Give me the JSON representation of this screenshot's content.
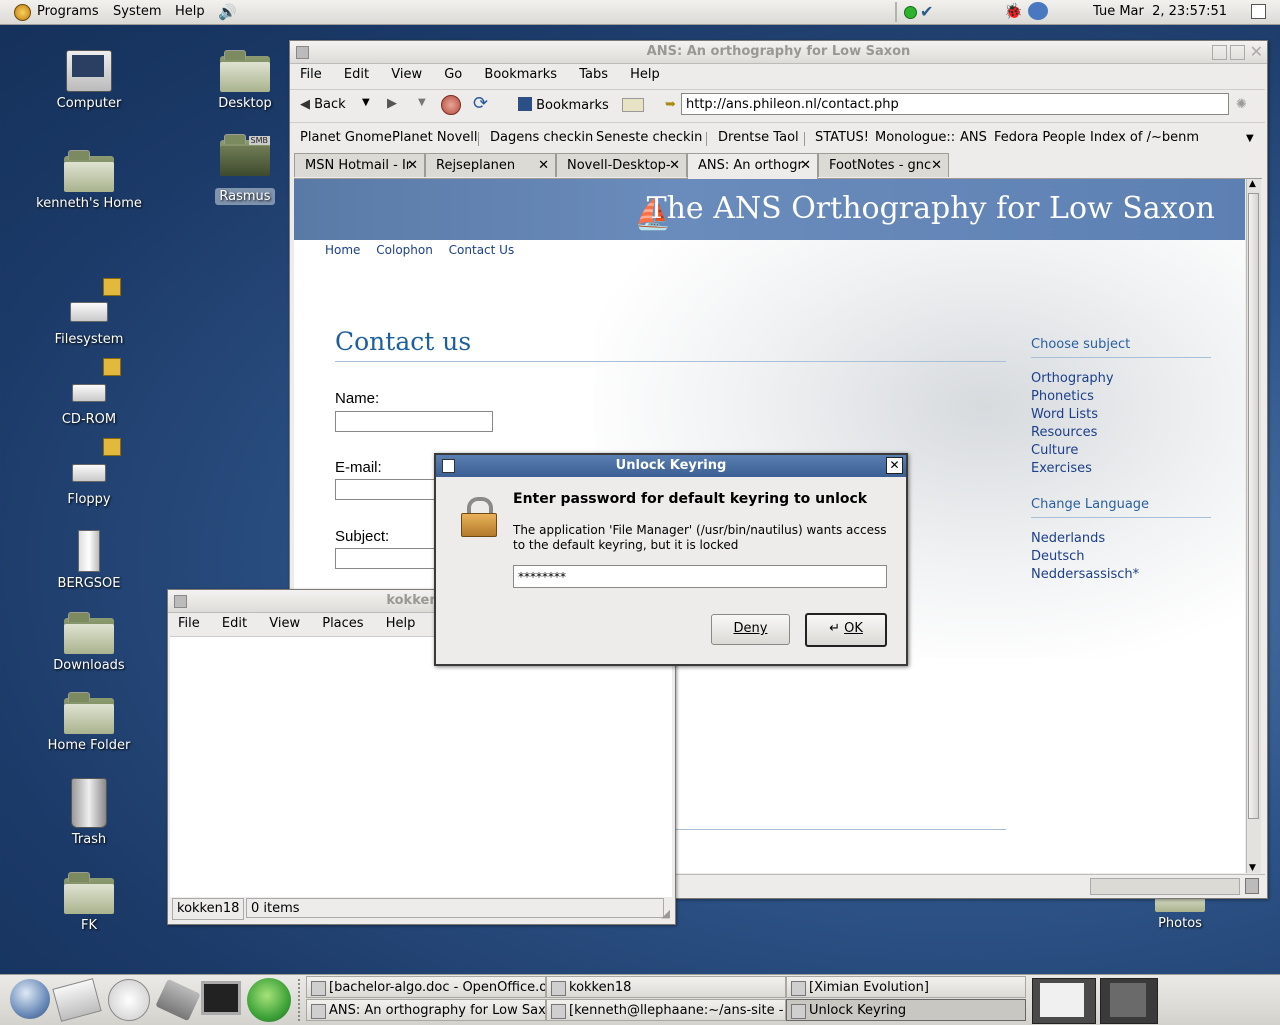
{
  "top_panel": {
    "menus": [
      "Programs",
      "System",
      "Help"
    ],
    "clock": "Tue Mar  2, 23:57:51"
  },
  "desktop": {
    "icons": [
      "Computer",
      "Desktop",
      "kenneth's Home",
      "Rasmus",
      "Filesystem",
      "CD-ROM",
      "Floppy",
      "BERGSOE",
      "Downloads",
      "Home Folder",
      "Trash",
      "FK",
      "Photos"
    ],
    "smb_badge": "SMB"
  },
  "browser": {
    "title": "ANS: An orthography for Low Saxon",
    "menus": [
      "File",
      "Edit",
      "View",
      "Go",
      "Bookmarks",
      "Tabs",
      "Help"
    ],
    "toolbar": {
      "back": "Back",
      "bookmarks": "Bookmarks"
    },
    "url": "http://ans.phileon.nl/contact.php",
    "bookmarks": [
      "Planet Gnome",
      "Planet Novell",
      "Dagens checkin",
      "Seneste checkin",
      "Drentse Taol",
      "STATUS!",
      "Monologue::",
      "ANS",
      "Fedora People",
      "Index of /~benm"
    ],
    "tabs": [
      "MSN Hotmail - Ir",
      "Rejseplanen",
      "Novell-Desktop-",
      "ANS: An orthogr",
      "FootNotes - gnc"
    ],
    "page": {
      "banner": "The ANS Orthography for Low Saxon",
      "nav": [
        "Home",
        "Colophon",
        "Contact Us"
      ],
      "heading": "Contact us",
      "fields": [
        "Name:",
        "E-mail:",
        "Subject:"
      ],
      "sidebar": {
        "subject_title": "Choose subject",
        "subjects": [
          "Orthography",
          "Phonetics",
          "Word Lists",
          "Resources",
          "Culture",
          "Exercises"
        ],
        "lang_title": "Change Language",
        "languages": [
          "Nederlands",
          "Deutsch",
          "Neddersassisch*"
        ]
      }
    }
  },
  "file_manager": {
    "title": "kokken18",
    "menus": [
      "File",
      "Edit",
      "View",
      "Places",
      "Help"
    ],
    "status_location": "kokken18",
    "status_count": "0 items"
  },
  "dialog": {
    "title": "Unlock Keyring",
    "heading": "Enter password for default keyring to unlock",
    "message": "The application 'File Manager' (/usr/bin/nautilus) wants access to the default keyring, but it is locked",
    "password": "********",
    "deny": "Deny",
    "ok": "OK"
  },
  "taskbar": {
    "tasks": [
      "[bachelor-algo.doc - OpenOffice.org",
      "kokken18",
      "[Ximian Evolution]",
      "ANS: An orthography for Low Saxon",
      "[kenneth@llephaane:~/ans-site - Ke",
      "Unlock Keyring"
    ]
  }
}
